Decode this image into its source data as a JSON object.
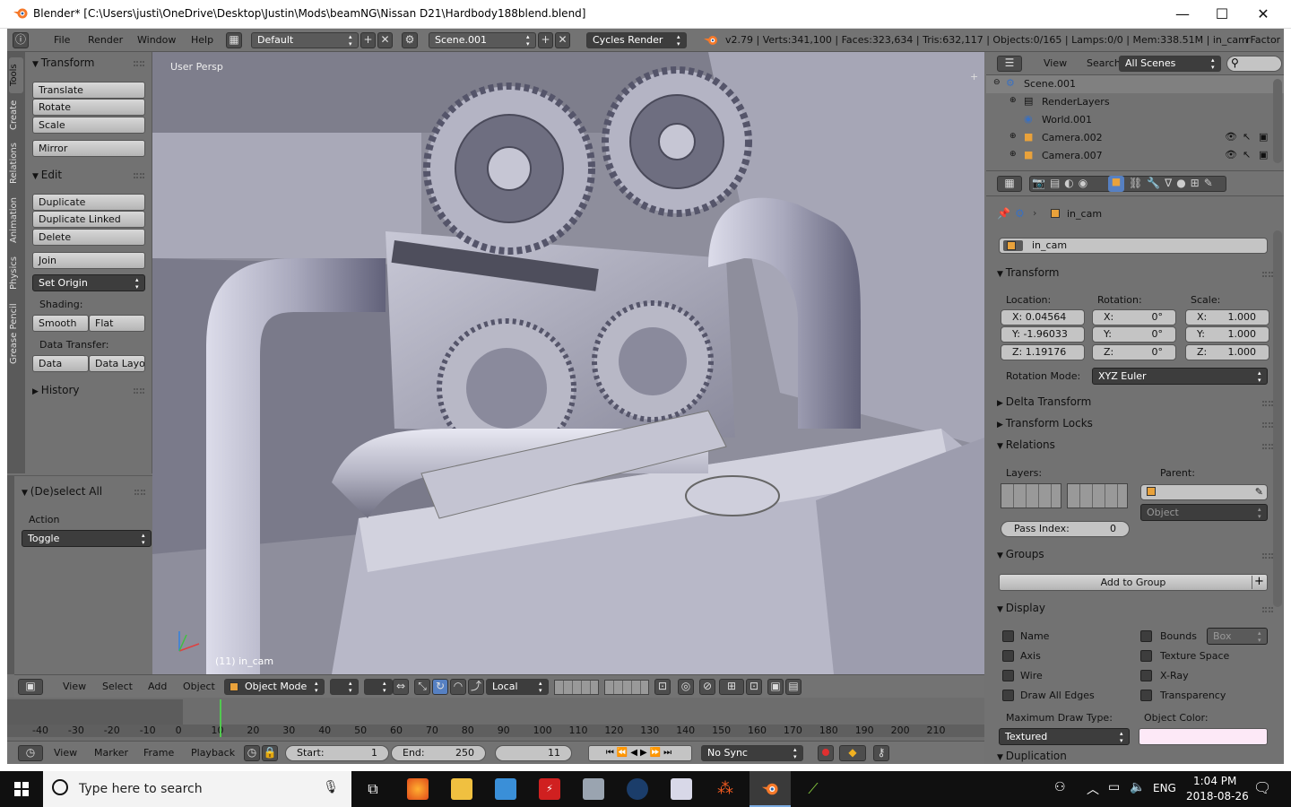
{
  "window": {
    "title": "Blender* [C:\\Users\\justi\\OneDrive\\Desktop\\Justin\\Mods\\beamNG\\Nissan D21\\Hardbody188blend.blend]",
    "minimize": "—",
    "maximize": "☐",
    "close": "✕"
  },
  "topbar": {
    "menus": [
      "File",
      "Render",
      "Window",
      "Help"
    ],
    "screen_layout": "Default",
    "scene": "Scene.001",
    "render_engine": "Cycles Render",
    "stats": "v2.79 | Verts:341,100 | Faces:323,634 | Tris:632,117 | Objects:0/165 | Lamps:0/0 | Mem:338.51M | in_cam",
    "right_text": "rFactor"
  },
  "tool_tabs": [
    "Tools",
    "Create",
    "Relations",
    "Animation",
    "Physics",
    "Grease Pencil"
  ],
  "toolshelf": {
    "transform_header": "Transform",
    "translate": "Translate",
    "rotate": "Rotate",
    "scale": "Scale",
    "mirror": "Mirror",
    "edit_header": "Edit",
    "duplicate": "Duplicate",
    "duplicate_linked": "Duplicate Linked",
    "delete": "Delete",
    "join": "Join",
    "set_origin": "Set Origin",
    "shading_label": "Shading:",
    "smooth": "Smooth",
    "flat": "Flat",
    "data_transfer_label": "Data Transfer:",
    "data": "Data",
    "data_layout": "Data Layo",
    "history_header": "History"
  },
  "operator": {
    "header": "(De)select All",
    "action_label": "Action",
    "action_value": "Toggle"
  },
  "viewport": {
    "view_label": "User Persp",
    "object_label": "(11) in_cam"
  },
  "view3d_header": {
    "menus": [
      "View",
      "Select",
      "Add",
      "Object"
    ],
    "mode": "Object Mode",
    "orientation": "Local"
  },
  "timeline": {
    "ticks": [
      "-40",
      "-30",
      "-20",
      "-10",
      "0",
      "10",
      "20",
      "30",
      "40",
      "50",
      "60",
      "70",
      "80",
      "90",
      "100",
      "110",
      "120",
      "130",
      "140",
      "150",
      "160",
      "170",
      "180",
      "190",
      "200",
      "210"
    ],
    "current_frame_marker": 11,
    "menus": [
      "View",
      "Marker",
      "Frame",
      "Playback"
    ],
    "start_label": "Start:",
    "start_value": "1",
    "end_label": "End:",
    "end_value": "250",
    "current": "11",
    "sync": "No Sync"
  },
  "outliner": {
    "menus": [
      "View",
      "Search"
    ],
    "filter": "All Scenes",
    "rows": [
      {
        "name": "Scene.001",
        "indent": 0
      },
      {
        "name": "RenderLayers",
        "indent": 1
      },
      {
        "name": "World.001",
        "indent": 1
      },
      {
        "name": "Camera.002",
        "indent": 1
      },
      {
        "name": "Camera.007",
        "indent": 1
      }
    ]
  },
  "properties": {
    "breadcrumb": "in_cam",
    "object_name": "in_cam",
    "transform_header": "Transform",
    "location_label": "Location:",
    "rotation_label": "Rotation:",
    "scale_label": "Scale:",
    "location": {
      "x": "X:  0.04564",
      "y": "Y:  -1.96033",
      "z": "Z:  1.19176"
    },
    "rotation": {
      "x_label": "X:",
      "x": "0°",
      "y_label": "Y:",
      "y": "0°",
      "z_label": "Z:",
      "z": "0°"
    },
    "scale": {
      "x_label": "X:",
      "x": "1.000",
      "y_label": "Y:",
      "y": "1.000",
      "z_label": "Z:",
      "z": "1.000"
    },
    "rotation_mode_label": "Rotation Mode:",
    "rotation_mode": "XYZ Euler",
    "delta_transform": "Delta Transform",
    "transform_locks": "Transform Locks",
    "relations": "Relations",
    "layers_label": "Layers:",
    "parent_label": "Parent:",
    "parent_type": "Object",
    "pass_index_label": "Pass Index:",
    "pass_index": "0",
    "groups": "Groups",
    "add_to_group": "Add to Group",
    "display": "Display",
    "name": "Name",
    "bounds": "Bounds",
    "bounds_type": "Box",
    "axis": "Axis",
    "texture_space": "Texture Space",
    "wire": "Wire",
    "xray": "X-Ray",
    "draw_all_edges": "Draw All Edges",
    "transparency": "Transparency",
    "max_draw_type_label": "Maximum Draw Type:",
    "object_color_label": "Object Color:",
    "max_draw_type": "Textured",
    "object_color": "#fde9f7",
    "duplication": "Duplication"
  },
  "taskbar": {
    "search_placeholder": "Type here to search",
    "lang": "ENG",
    "time": "1:04 PM",
    "date": "2018-08-26"
  }
}
